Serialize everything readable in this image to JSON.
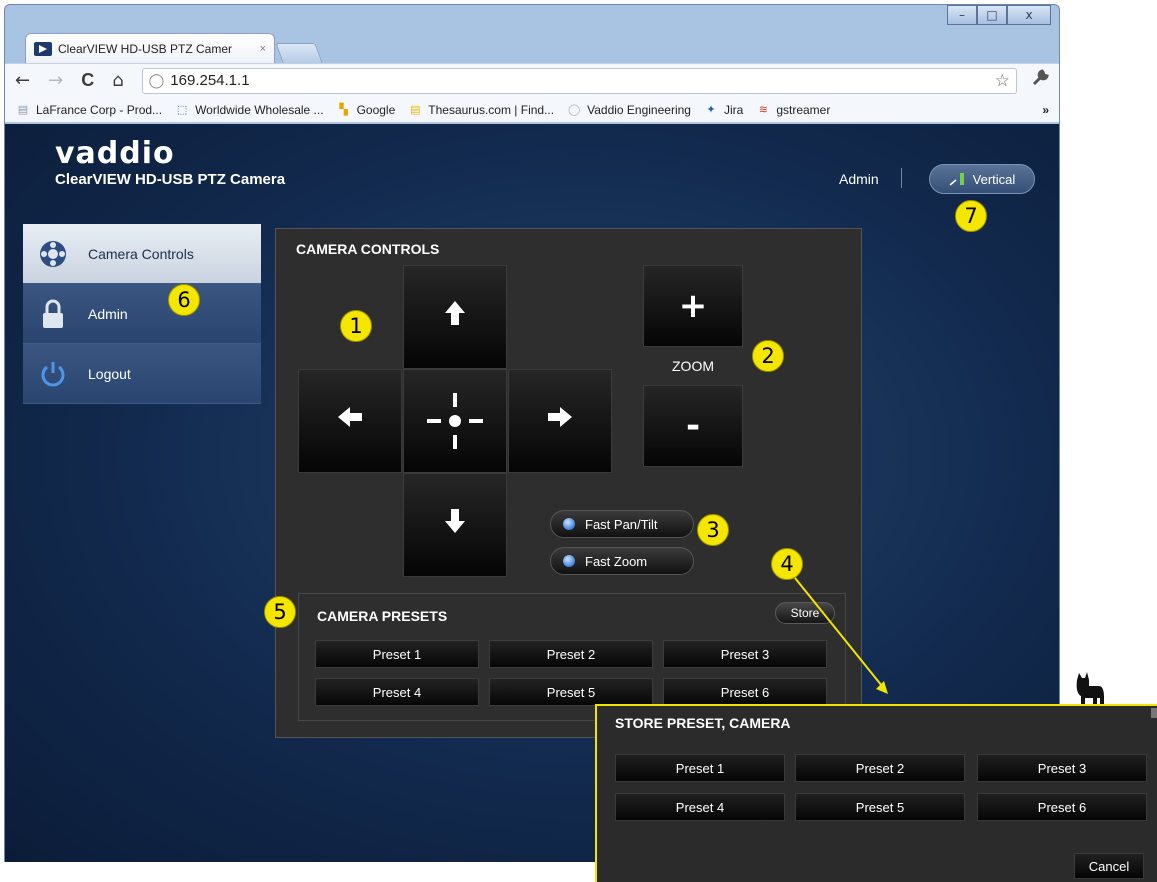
{
  "browser": {
    "tab_title": "ClearVIEW HD-USB PTZ Camer",
    "tab_close": "×",
    "window_controls": {
      "minimize": "–",
      "maximize": "□",
      "close": "x"
    },
    "nav": {
      "back": "←",
      "forward": "→",
      "reload": "C",
      "home": "⌂"
    },
    "address": "169.254.1.1",
    "address_icon": "globe-icon",
    "bookmark_star": "☆",
    "wrench": "🔧",
    "bookmarks": [
      {
        "label": "LaFrance Corp - Prod...",
        "icon": "page-icon",
        "color": "#8a9bb0"
      },
      {
        "label": "Worldwide Wholesale ...",
        "icon": "cursor-icon",
        "color": "#2b5fb0"
      },
      {
        "label": "Google",
        "icon": "google-icon",
        "color": "#e8a400"
      },
      {
        "label": "Thesaurus.com | Find...",
        "icon": "thesaurus-icon",
        "color": "#f2b600"
      },
      {
        "label": "Vaddio Engineering",
        "icon": "globe-icon",
        "color": "#b0b0b0"
      },
      {
        "label": "Jira",
        "icon": "jira-icon",
        "color": "#1f5fb5"
      },
      {
        "label": "gstreamer",
        "icon": "gstreamer-icon",
        "color": "#d23a2a"
      }
    ],
    "bookmarks_more": "»"
  },
  "header": {
    "logo": "vaddio",
    "product": "ClearVIEW HD-USB PTZ Camera",
    "admin_label": "Admin",
    "vertical_button": "Vertical"
  },
  "sidebar": {
    "items": [
      {
        "label": "Camera Controls",
        "icon": "camera-controls-icon",
        "active": true
      },
      {
        "label": "Admin",
        "icon": "lock-icon",
        "active": false
      },
      {
        "label": "Logout",
        "icon": "power-icon",
        "active": false
      }
    ]
  },
  "controls": {
    "title": "CAMERA CONTROLS",
    "zoom_label": "ZOOM",
    "zoom_in": "+",
    "zoom_out": "-",
    "fast_pan_tilt": "Fast Pan/Tilt",
    "fast_zoom": "Fast Zoom",
    "arrows": {
      "up": "🡅",
      "down": "🡇",
      "left": "🡄",
      "right": "🡆"
    }
  },
  "presets": {
    "title": "CAMERA PRESETS",
    "store": "Store",
    "items": [
      "Preset 1",
      "Preset 2",
      "Preset 3",
      "Preset 4",
      "Preset 5",
      "Preset 6"
    ]
  },
  "store_popup": {
    "title": "STORE PRESET, CAMERA",
    "items": [
      "Preset 1",
      "Preset 2",
      "Preset 3",
      "Preset 4",
      "Preset 5",
      "Preset 6"
    ],
    "cancel": "Cancel"
  },
  "callouts": [
    "1",
    "2",
    "3",
    "4",
    "5",
    "6",
    "7"
  ],
  "colors": {
    "callout_yellow": "#f5e600",
    "page_blue": "#122a4e",
    "panel_gray": "#2e2e2e"
  }
}
